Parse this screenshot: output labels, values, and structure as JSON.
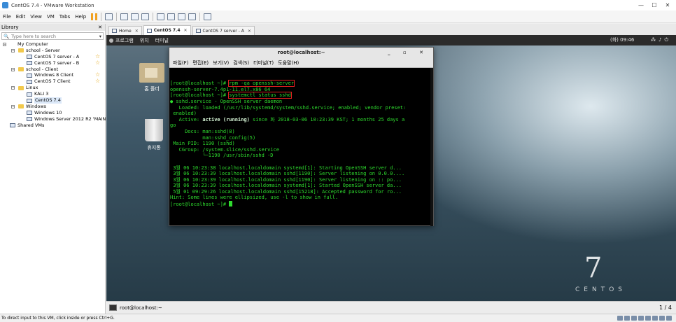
{
  "app": {
    "title": "CentOS 7.4 - VMware Workstation",
    "window_controls": [
      "—",
      "☐",
      "✕"
    ]
  },
  "menu": [
    "File",
    "Edit",
    "View",
    "VM",
    "Tabs",
    "Help"
  ],
  "library": {
    "title": "Library",
    "close": "✕",
    "search_placeholder": "Type here to search",
    "tree": [
      {
        "label": "My Computer",
        "kind": "computer",
        "depth": 0,
        "expander": "−"
      },
      {
        "label": "school - Server",
        "kind": "folder",
        "depth": 1,
        "expander": "−"
      },
      {
        "label": "CentOS 7 server - A",
        "kind": "vm",
        "depth": 2,
        "star": true
      },
      {
        "label": "CentOS 7 server - B",
        "kind": "vm",
        "depth": 2,
        "star": true
      },
      {
        "label": "school - Client",
        "kind": "folder",
        "depth": 1,
        "expander": "−"
      },
      {
        "label": "Windows 8 Client",
        "kind": "vm",
        "depth": 2,
        "star": true
      },
      {
        "label": "CentOS 7 Client",
        "kind": "vm",
        "depth": 2,
        "star": true
      },
      {
        "label": "Linux",
        "kind": "folder",
        "depth": 1,
        "expander": "−"
      },
      {
        "label": "KALI 3",
        "kind": "vm",
        "depth": 2
      },
      {
        "label": "CentOS 7.4",
        "kind": "vm",
        "depth": 2,
        "selected": true
      },
      {
        "label": "Windows",
        "kind": "folder",
        "depth": 1,
        "expander": "−"
      },
      {
        "label": "Windows 10",
        "kind": "vm",
        "depth": 2
      },
      {
        "label": "Windows Server 2012 R2 'MAIN'",
        "kind": "vm",
        "depth": 2
      },
      {
        "label": "Shared VMs",
        "kind": "vm",
        "depth": 0
      }
    ]
  },
  "tabs": [
    {
      "label": "Home",
      "active": false
    },
    {
      "label": "CentOS 7.4",
      "active": true
    },
    {
      "label": "CentOS 7 server - A",
      "active": false
    }
  ],
  "guest": {
    "topbar": {
      "apps": "프로그램",
      "places": "위치",
      "terminal": "터미널",
      "clock": "(화) 09:46"
    },
    "desktop_icons": [
      {
        "label": "홈 폴더",
        "icon": "home-folder-icon"
      },
      {
        "label": "휴지통",
        "icon": "trash-icon"
      }
    ],
    "terminal": {
      "title": "root@localhost:~",
      "controls": "_ ▫ ✕",
      "menu": [
        "파일(F)",
        "편집(E)",
        "보기(V)",
        "검색(S)",
        "터미널(T)",
        "도움말(H)"
      ],
      "lines": [
        {
          "prompt": "[root@localhost ~]# ",
          "cmd": "rpm -qa openssh-server",
          "boxed": true
        },
        {
          "text": "openssh-server-7.4p1-11.el7.x86_64"
        },
        {
          "prompt": "[root@localhost ~]# ",
          "cmd": "systemctl status sshd",
          "boxed": true
        },
        {
          "text": "● sshd.service - OpenSSH server daemon"
        },
        {
          "text": "   Loaded: loaded (/usr/lib/systemd/system/sshd.service; enabled; vendor preset:"
        },
        {
          "text": " enabled)"
        },
        {
          "text": "   Active: ",
          "strong": "active (running)",
          "after": " since 화 2018-03-06 10:23:39 KST; 1 months 25 days a"
        },
        {
          "text": "go"
        },
        {
          "text": "     Docs: man:sshd(8)"
        },
        {
          "text": "           man:sshd_config(5)"
        },
        {
          "text": " Main PID: 1190 (sshd)"
        },
        {
          "text": "   CGroup: /system.slice/sshd.service"
        },
        {
          "text": "           └─1190 /usr/sbin/sshd -D"
        },
        {
          "text": ""
        },
        {
          "text": " 3월 06 10:23:38 localhost.localdomain systemd[1]: Starting OpenSSH server d..."
        },
        {
          "text": " 3월 06 10:23:39 localhost.localdomain sshd[1190]: Server listening on 0.0.0...."
        },
        {
          "text": " 3월 06 10:23:39 localhost.localdomain sshd[1190]: Server listening on :: po..."
        },
        {
          "text": " 3월 06 10:23:39 localhost.localdomain systemd[1]: Started OpenSSH server da..."
        },
        {
          "text": " 5월 01 09:29:26 localhost.localdomain sshd[15218]: Accepted password for ro..."
        },
        {
          "text": "Hint: Some lines were ellipsized, use -l to show in full."
        },
        {
          "prompt": "[root@localhost ~]# ",
          "cursor": true
        }
      ]
    },
    "brand_number": "7",
    "brand_word": "CENTOS",
    "taskbar_item": "root@localhost:~",
    "pager": "1 / 4"
  },
  "statusbar": "To direct input to this VM, click inside or press Ctrl+G."
}
